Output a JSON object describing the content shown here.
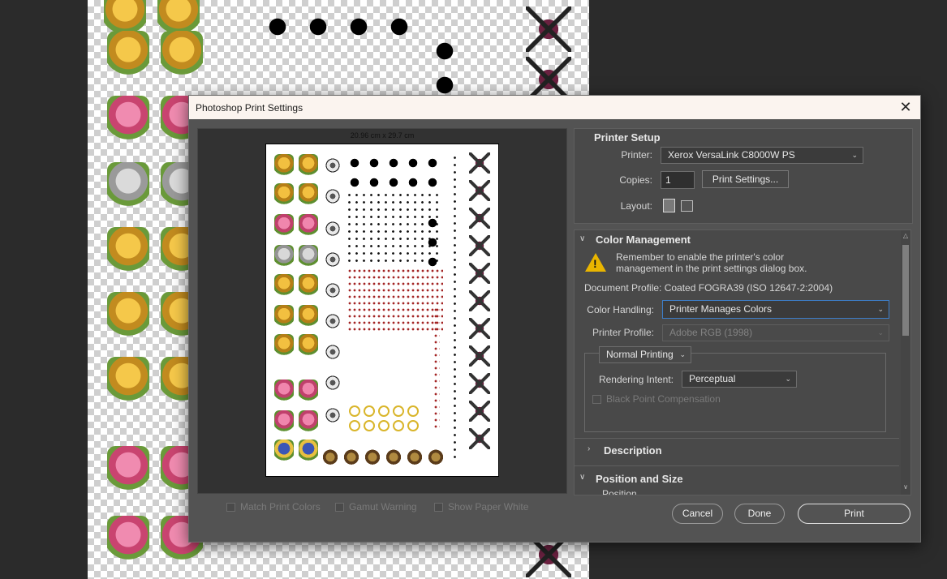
{
  "dialog": {
    "title": "Photoshop Print Settings",
    "close_glyph": "✕"
  },
  "preview": {
    "paper_size": "20.96 cm x 29.7 cm",
    "checkboxes": [
      {
        "label": "Match Print Colors",
        "checked": false
      },
      {
        "label": "Gamut Warning",
        "checked": false
      },
      {
        "label": "Show Paper White",
        "checked": false
      }
    ]
  },
  "printer_setup": {
    "title": "Printer Setup",
    "printer_label": "Printer:",
    "printer_value": "Xerox VersaLink C8000W PS",
    "copies_label": "Copies:",
    "copies_value": "1",
    "print_settings_button": "Print Settings...",
    "layout_label": "Layout:",
    "layout_icons": [
      "portrait-layout-icon",
      "landscape-layout-icon"
    ]
  },
  "color_management": {
    "title": "Color Management",
    "warning_line1": "Remember to enable the printer's color",
    "warning_line2": "management in the print settings dialog box.",
    "document_profile": "Document Profile: Coated FOGRA39 (ISO 12647-2:2004)",
    "color_handling_label": "Color Handling:",
    "color_handling_value": "Printer Manages Colors",
    "printer_profile_label": "Printer Profile:",
    "printer_profile_value": "Adobe RGB (1998)",
    "printing_mode": "Normal Printing",
    "rendering_intent_label": "Rendering Intent:",
    "rendering_intent_value": "Perceptual",
    "black_point_label": "Black Point Compensation",
    "black_point_checked": false
  },
  "sections": {
    "description": "Description",
    "position_and_size": "Position and Size",
    "position": "Position"
  },
  "footer": {
    "cancel": "Cancel",
    "done": "Done",
    "print": "Print"
  },
  "colors": {
    "dialog_bg": "#535353",
    "titlebar_bg": "#fbf4ef",
    "accent_focus": "#3d7ec9",
    "warning": "#e9b500"
  }
}
